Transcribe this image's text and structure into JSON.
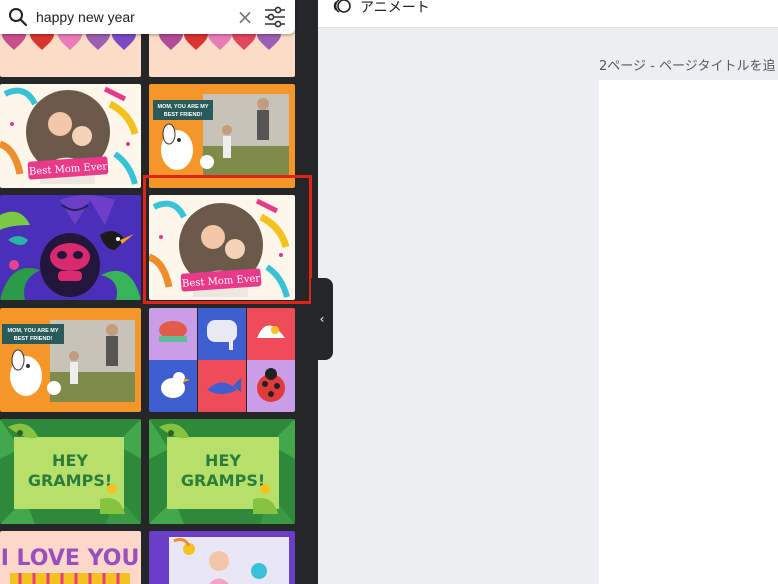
{
  "search": {
    "value": "happy new year",
    "clear_icon": "×"
  },
  "templates": [
    {
      "name": "hearts-strip"
    },
    {
      "name": "hearts-strip"
    },
    {
      "name": "best-mom-ever",
      "label": "Best Mom Ever"
    },
    {
      "name": "mom-best-friend",
      "label": "MOM, YOU ARE MY BEST FRIEND!"
    },
    {
      "name": "jungle-gorilla"
    },
    {
      "name": "best-mom-ever-selected",
      "label": "Best Mom Ever"
    },
    {
      "name": "mom-best-friend",
      "label": "MOM, YOU ARE MY BEST FRIEND!"
    },
    {
      "name": "animal-grid"
    },
    {
      "name": "hey-gramps",
      "line1": "HEY",
      "line2": "GRAMPS!"
    },
    {
      "name": "hey-gramps",
      "line1": "HEY",
      "line2": "GRAMPS!"
    },
    {
      "name": "i-love-you",
      "label": "I LOVE YOU"
    },
    {
      "name": "purple-photo"
    }
  ],
  "collapse_icon": "‹",
  "toolbar": {
    "animate_label": "アニメート"
  },
  "page": {
    "label": "2ページ - ページタイトルを追"
  },
  "colors": {
    "panel_bg": "#252627",
    "selected_outline": "#e2231a",
    "workspace_bg": "#eceef1"
  }
}
